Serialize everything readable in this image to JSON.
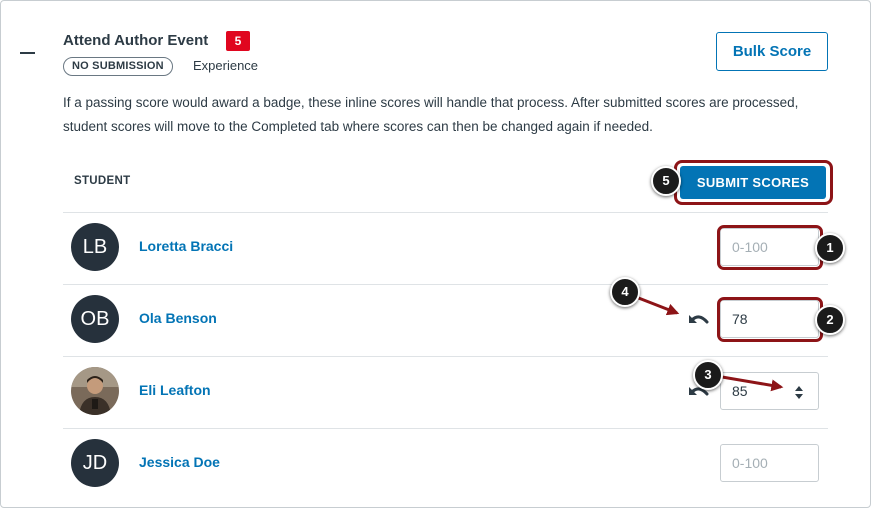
{
  "assignment": {
    "title": "Attend Author Event",
    "count_badge": "5",
    "submission_pill": "NO SUBMISSION",
    "type": "Experience",
    "bulk_score_label": "Bulk Score",
    "info_text": "If a passing score would award a badge, these inline scores will handle that process. After submitted scores are processed, student scores will move to the Completed tab where scores can then be changed again if needed."
  },
  "table": {
    "student_header": "STUDENT",
    "submit_label": "SUBMIT SCORES",
    "rows": [
      {
        "initials": "LB",
        "name": "Loretta Bracci",
        "score": "",
        "placeholder": "0-100"
      },
      {
        "initials": "OB",
        "name": "Ola Benson",
        "score": "78",
        "placeholder": "0-100"
      },
      {
        "initials": "",
        "name": "Eli Leafton",
        "score": "85",
        "placeholder": "0-100"
      },
      {
        "initials": "JD",
        "name": "Jessica Doe",
        "score": "",
        "placeholder": "0-100"
      }
    ]
  },
  "callouts": [
    "1",
    "2",
    "3",
    "4",
    "5"
  ],
  "colors": {
    "brand_blue": "#0374b5",
    "badge_red": "#e0061f",
    "annotation_red": "#8d1417",
    "avatar_dark": "#26313c"
  },
  "icons": {
    "collapse": "minus-icon",
    "revert": "undo-icon",
    "stepper": "stepper-arrows-icon"
  }
}
